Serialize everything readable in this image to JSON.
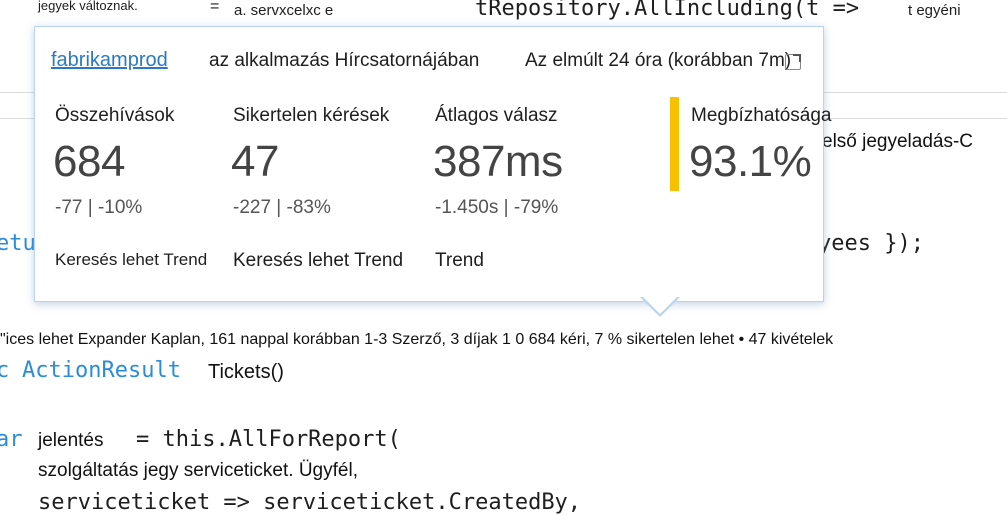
{
  "editor": {
    "top_left_text": "jegyek változnak.",
    "top_eq": "=",
    "top_label": "a. servxcelxc e",
    "top_code": "tRepository.AllIncluding(t =>",
    "top_right_text": "t egyéni",
    "side_label": "első jegyeladás-C",
    "retu_fragment": "etu",
    "yees_fragment": "yees });",
    "codelens_line": "\"ices lehet Expander Kaplan, 161 nappal korábban 1-3 Szerző, 3 díjak 1 0 684 kéri, 7 % sikertelen lehet • 47 kivételek",
    "c_fragment": "c",
    "action_result": "ActionResult",
    "tickets": "Tickets()",
    "ar_fragment": "ar",
    "jelentes": "jelentés",
    "eq_this": "= this.AllForReport(",
    "service_line": "szolgáltatás jegy serviceticket. Ügyfél,",
    "bottom_code": "serviceticket => serviceticket.CreatedBy,"
  },
  "popup": {
    "app_link": "fabrikamprod",
    "header_middle": "az alkalmazás Hírcsatornájában",
    "header_time": "Az elmúlt 24 óra (korábban 7m)",
    "metrics": [
      {
        "title": "Összehívások",
        "value": "684",
        "delta": "-77 | -10%",
        "link": "Keresés lehet Trend"
      },
      {
        "title": "Sikertelen kérések",
        "value": "47",
        "delta": "-227 | -83%",
        "link": "Keresés lehet Trend"
      },
      {
        "title": "Átlagos válasz",
        "value": "387ms",
        "delta": "-1.450s | -79%",
        "link": "Trend"
      },
      {
        "title": "Megbízhatósága",
        "value": "93.1%"
      }
    ],
    "accent_color": "#f6c200"
  }
}
